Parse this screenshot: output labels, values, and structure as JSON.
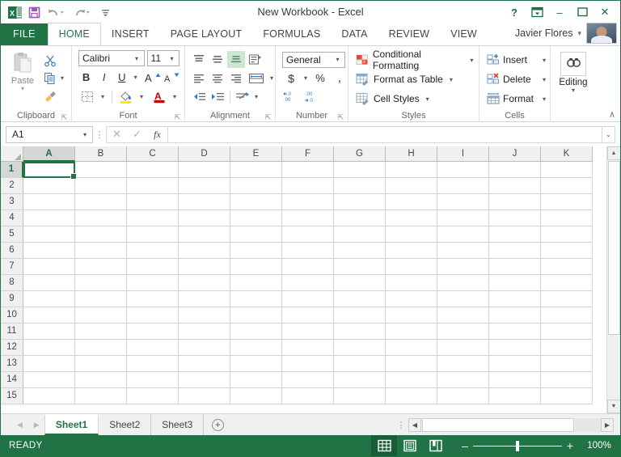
{
  "titlebar": {
    "app_icon": "excel-logo-icon",
    "quick_access": [
      {
        "name": "save-icon",
        "label": "Save"
      },
      {
        "name": "undo-icon",
        "label": "Undo"
      },
      {
        "name": "redo-icon",
        "label": "Redo"
      },
      {
        "name": "customize-qat-icon",
        "label": "Customize Quick Access Toolbar"
      }
    ],
    "title": "New Workbook - Excel",
    "help_label": "?",
    "ribbon_display_label": "Ribbon Display Options",
    "minimize_label": "–",
    "restore_label": "❐",
    "close_label": "✕"
  },
  "ribbon_tabs": {
    "file": "FILE",
    "items": [
      {
        "label": "HOME",
        "active": true
      },
      {
        "label": "INSERT",
        "active": false
      },
      {
        "label": "PAGE LAYOUT",
        "active": false
      },
      {
        "label": "FORMULAS",
        "active": false
      },
      {
        "label": "DATA",
        "active": false
      },
      {
        "label": "REVIEW",
        "active": false
      },
      {
        "label": "VIEW",
        "active": false
      }
    ],
    "user_name": "Javier Flores"
  },
  "ribbon": {
    "clipboard": {
      "label": "Clipboard",
      "paste_label": "Paste",
      "cut_label": "Cut",
      "copy_label": "Copy",
      "format_painter_label": "Format Painter"
    },
    "font": {
      "label": "Font",
      "font_name": "Calibri",
      "font_size": "11",
      "bold_label": "B",
      "italic_label": "I",
      "underline_label": "U",
      "grow_font_label": "A",
      "shrink_font_label": "A",
      "borders_label": "Borders",
      "fill_color_label": "Fill Color",
      "font_color_label": "A"
    },
    "alignment": {
      "label": "Alignment",
      "top_align_label": "Top Align",
      "middle_align_label": "Middle Align",
      "bottom_align_label": "Bottom Align",
      "orientation_label": "Orientation",
      "align_left_label": "Align Left",
      "center_label": "Center",
      "align_right_label": "Align Right",
      "merge_center_label": "Merge & Center",
      "decrease_indent_label": "Decrease Indent",
      "increase_indent_label": "Increase Indent",
      "wrap_text_label": "Wrap Text"
    },
    "number": {
      "label": "Number",
      "format": "General",
      "currency_label": "$",
      "percent_label": "%",
      "comma_label": ",",
      "increase_decimal_label": "Increase Decimal",
      "decrease_decimal_label": "Decrease Decimal"
    },
    "styles": {
      "label": "Styles",
      "items": [
        {
          "label": "Conditional Formatting"
        },
        {
          "label": "Format as Table"
        },
        {
          "label": "Cell Styles"
        }
      ]
    },
    "cells": {
      "label": "Cells",
      "items": [
        {
          "label": "Insert"
        },
        {
          "label": "Delete"
        },
        {
          "label": "Format"
        }
      ]
    },
    "editing": {
      "label": "Editing",
      "icon": "find-select-icon"
    },
    "collapse_label": "∧"
  },
  "formula_bar": {
    "name_box_value": "A1",
    "cancel_label": "✕",
    "enter_label": "✓",
    "insert_function_label": "fx",
    "formula_value": "",
    "expand_label": "⌄"
  },
  "grid": {
    "columns": [
      "A",
      "B",
      "C",
      "D",
      "E",
      "F",
      "G",
      "H",
      "I",
      "J",
      "K"
    ],
    "rows": [
      "1",
      "2",
      "3",
      "4",
      "5",
      "6",
      "7",
      "8",
      "9",
      "10",
      "11",
      "12",
      "13",
      "14",
      "15"
    ],
    "active_cell": "A1",
    "active_col_index": 0,
    "active_row_index": 0
  },
  "sheet_tabs": {
    "prev_label": "◀",
    "next_label": "▶",
    "tabs": [
      {
        "label": "Sheet1",
        "active": true
      },
      {
        "label": "Sheet2",
        "active": false
      },
      {
        "label": "Sheet3",
        "active": false
      }
    ],
    "add_label": "+"
  },
  "statusbar": {
    "status": "READY",
    "views": [
      {
        "name": "normal-view-icon",
        "active": true
      },
      {
        "name": "page-layout-view-icon",
        "active": false
      },
      {
        "name": "page-break-view-icon",
        "active": false
      }
    ],
    "zoom_out_label": "–",
    "zoom_in_label": "+",
    "zoom_level": "100%"
  },
  "colors": {
    "excel_green": "#217346",
    "dark_green": "#1a5c38",
    "selection_green": "#1d6f42",
    "ribbon_bg": "#ffffff",
    "header_gray": "#f0f0f0"
  }
}
